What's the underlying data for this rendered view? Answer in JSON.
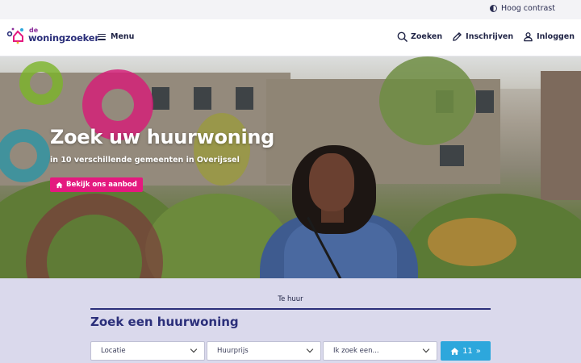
{
  "topbar": {
    "contrast_label": "Hoog contrast",
    "contrast_icon": "contrast-icon"
  },
  "header": {
    "logo_small": "de",
    "logo_name": "woningzoeker",
    "menu_label": "Menu",
    "nav": [
      {
        "label": "Zoeken",
        "icon": "search-icon"
      },
      {
        "label": "Inschrijven",
        "icon": "pencil-icon"
      },
      {
        "label": "Inloggen",
        "icon": "user-icon"
      }
    ]
  },
  "hero": {
    "title": "Zoek uw huurwoning",
    "subtitle": "in 10 verschillende gemeenten in Overijssel",
    "cta_label": "Bekijk ons aanbod",
    "cta_icon": "home-icon"
  },
  "search": {
    "tab_label": "Te huur",
    "title": "Zoek een huurwoning",
    "fields": [
      {
        "label": "Locatie"
      },
      {
        "label": "Huurprijs"
      },
      {
        "label": "Ik zoek een..."
      }
    ],
    "results_count": "11",
    "results_arrow": "»"
  },
  "colors": {
    "brand_pink": "#e4197f",
    "brand_navy": "#2b2f7a",
    "accent_blue": "#2da7dc",
    "search_bg": "#dad9ec"
  }
}
